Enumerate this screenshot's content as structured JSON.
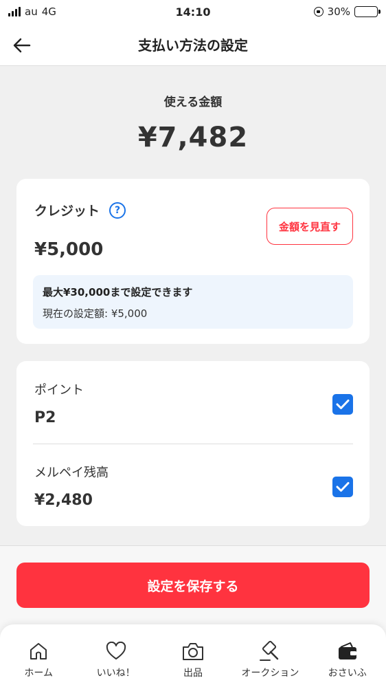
{
  "status_bar": {
    "carrier": "au",
    "network": "4G",
    "time": "14:10",
    "battery_text": "30%",
    "battery_level": 0.3
  },
  "header": {
    "title": "支払い方法の設定",
    "back_icon": "arrow-left-icon"
  },
  "available": {
    "label": "使える金額",
    "amount": "¥7,482"
  },
  "credit": {
    "title": "クレジット",
    "help_icon": "question-circle-icon",
    "review_label": "金額を見直す",
    "amount": "¥5,000",
    "limit_max": "最大¥30,000まで設定できます",
    "limit_current": "現在の設定額: ¥5,000"
  },
  "sources": [
    {
      "label": "ポイント",
      "amount": "P2",
      "checked": true
    },
    {
      "label": "メルペイ残高",
      "amount": "¥2,480",
      "checked": true
    }
  ],
  "save_label": "設定を保存する",
  "tabs": [
    {
      "label": "ホーム",
      "icon": "home-icon"
    },
    {
      "label": "いいね！",
      "icon": "heart-icon"
    },
    {
      "label": "出品",
      "icon": "camera-icon"
    },
    {
      "label": "オークション",
      "icon": "gavel-icon"
    },
    {
      "label": "おさいふ",
      "icon": "wallet-icon"
    }
  ],
  "colors": {
    "accent_red": "#ff333f",
    "accent_blue": "#1a73e8",
    "background": "#f0f0f0"
  }
}
